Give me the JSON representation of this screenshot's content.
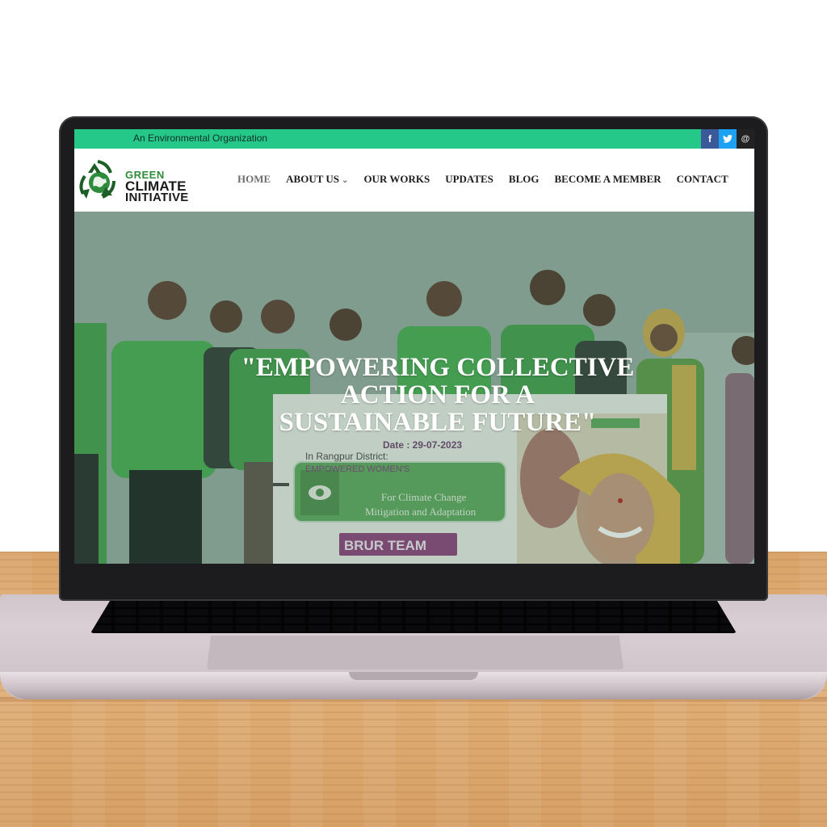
{
  "site": {
    "tagline": "An Environmental Organization",
    "logo": {
      "line1": "GREEN",
      "line2": "CLIMATE",
      "line3": "INITIATIVE"
    },
    "social": [
      {
        "icon": "facebook-icon",
        "glyph": "f"
      },
      {
        "icon": "twitter-icon",
        "glyph": "t"
      },
      {
        "icon": "instagram-icon",
        "glyph": "@"
      }
    ],
    "nav": [
      {
        "label": "HOME",
        "active": true
      },
      {
        "label": "ABOUT US",
        "dropdown": true
      },
      {
        "label": "OUR WORKS"
      },
      {
        "label": "UPDATES"
      },
      {
        "label": "BLOG"
      },
      {
        "label": "BECOME A MEMBER"
      },
      {
        "label": "CONTACT"
      }
    ],
    "hero": {
      "headline_line1": "\"EMPOWERING COLLECTIVE",
      "headline_line2": "ACTION FOR A",
      "headline_line3": "SUSTAINABLE FUTURE\"",
      "banner": {
        "date": "Date : 29-07-2023",
        "district": "In Rangpur District:",
        "subtitle": "EMPOWERED WOMEN'S",
        "goal": "For Climate Change",
        "goal2": "Mitigation and Adaptation",
        "team": "BRUR TEAM"
      }
    },
    "colors": {
      "topbar": "#25c889",
      "brand_green": "#2e8b3b",
      "shirt_green": "#4caf50"
    }
  }
}
